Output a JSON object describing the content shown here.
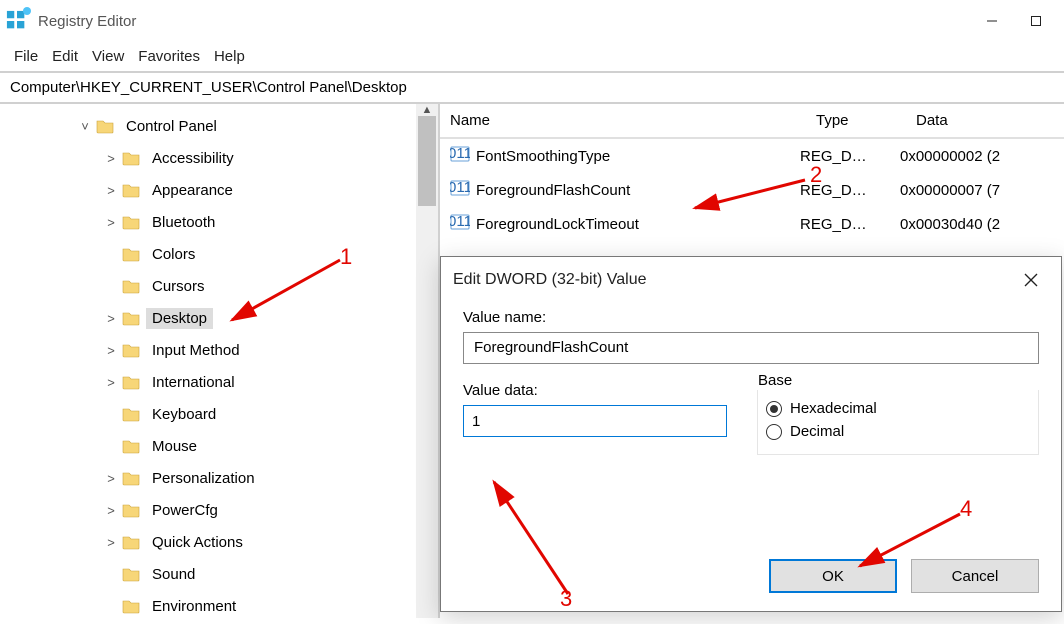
{
  "window": {
    "title": "Registry Editor"
  },
  "menu": {
    "file": "File",
    "edit": "Edit",
    "view": "View",
    "favorites": "Favorites",
    "help": "Help"
  },
  "address": {
    "path": "Computer\\HKEY_CURRENT_USER\\Control Panel\\Desktop"
  },
  "tree": {
    "root": "Control Panel",
    "items": [
      {
        "label": "Accessibility",
        "expandable": true
      },
      {
        "label": "Appearance",
        "expandable": true
      },
      {
        "label": "Bluetooth",
        "expandable": true
      },
      {
        "label": "Colors",
        "expandable": false
      },
      {
        "label": "Cursors",
        "expandable": false
      },
      {
        "label": "Desktop",
        "expandable": true,
        "selected": true
      },
      {
        "label": "Input Method",
        "expandable": true
      },
      {
        "label": "International",
        "expandable": true
      },
      {
        "label": "Keyboard",
        "expandable": false
      },
      {
        "label": "Mouse",
        "expandable": false
      },
      {
        "label": "Personalization",
        "expandable": true
      },
      {
        "label": "PowerCfg",
        "expandable": true
      },
      {
        "label": "Quick Actions",
        "expandable": true
      },
      {
        "label": "Sound",
        "expandable": false
      },
      {
        "label": "Environment",
        "expandable": false
      }
    ]
  },
  "list": {
    "columns": {
      "name": "Name",
      "type": "Type",
      "data": "Data"
    },
    "rows": [
      {
        "name": "FontSmoothingType",
        "type": "REG_D…",
        "data": "0x00000002 (2"
      },
      {
        "name": "ForegroundFlashCount",
        "type": "REG_D…",
        "data": "0x00000007 (7"
      },
      {
        "name": "ForegroundLockTimeout",
        "type": "REG_D…",
        "data": "0x00030d40 (2"
      }
    ]
  },
  "dialog": {
    "title": "Edit DWORD (32-bit) Value",
    "value_name_label": "Value name:",
    "value_name": "ForegroundFlashCount",
    "value_data_label": "Value data:",
    "value_data": "1",
    "base_label": "Base",
    "hex_label": "Hexadecimal",
    "dec_label": "Decimal",
    "ok": "OK",
    "cancel": "Cancel"
  },
  "annotations": {
    "n1": "1",
    "n2": "2",
    "n3": "3",
    "n4": "4"
  }
}
